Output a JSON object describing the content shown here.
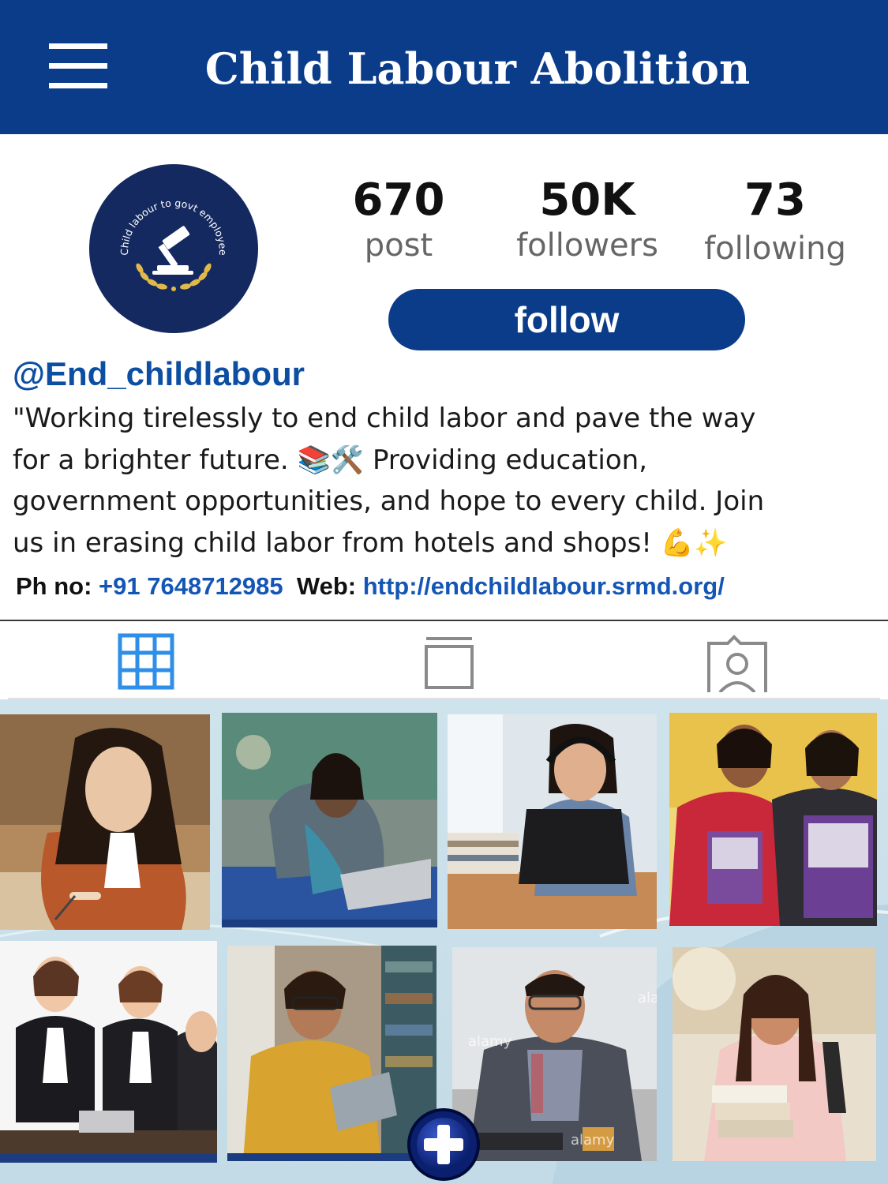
{
  "header": {
    "title": "Child Labour Abolition",
    "menu_icon": "hamburger-menu-icon",
    "background_color": "#0b3c8a"
  },
  "profile": {
    "avatar_text": "Child labour to govt employee",
    "avatar_icon": "gavel-icon",
    "stats": {
      "posts": {
        "value": "670",
        "label": "post"
      },
      "followers": {
        "value": "50K",
        "label": "followers"
      },
      "following": {
        "value": "73",
        "label": "following"
      }
    },
    "follow_label": "follow",
    "username": "@End_childlabour",
    "bio_lines": [
      "\"Working tirelessly to end child labor and pave the way",
      "for a brighter future. 📚🛠️ Providing education,",
      "government opportunities, and hope to every child. Join",
      "us in erasing child labor from hotels and shops! 💪✨"
    ],
    "contact": {
      "phone_label": "Ph no:",
      "phone": "+91 7648712985",
      "web_label": "Web:",
      "web": "http://endchildlabour.srmd.org/"
    }
  },
  "tabs": [
    {
      "name": "grid",
      "icon": "grid-icon",
      "active": true
    },
    {
      "name": "feed",
      "icon": "feed-icon",
      "active": false
    },
    {
      "name": "tagged",
      "icon": "tagged-person-icon",
      "active": false
    }
  ],
  "posts": [
    {
      "subject": "woman studying with pen"
    },
    {
      "subject": "student at laptop in classroom"
    },
    {
      "subject": "woman with headphones at laptop"
    },
    {
      "subject": "two students holding books"
    },
    {
      "subject": "business team handshake"
    },
    {
      "subject": "man with tablet in library"
    },
    {
      "subject": "officer at desk"
    },
    {
      "subject": "smiling woman holding books"
    }
  ],
  "watermarks": [
    "ala",
    "alamy",
    "alamy"
  ],
  "add_button_icon": "plus-icon",
  "colors": {
    "brand": "#0b3c8a",
    "link": "#1456b5",
    "active_tab": "#2e8ee8",
    "inactive_tab": "#888888"
  }
}
